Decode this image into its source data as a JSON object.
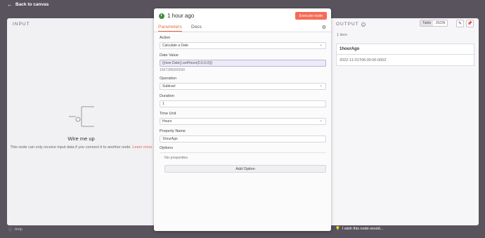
{
  "topbar": {
    "back_label": "Back to canvas"
  },
  "input_panel": {
    "label": "INPUT",
    "wire_title": "Wire me up",
    "wire_text": "This node can only receive input data if you connect it to another node.",
    "learn_more": "Learn more"
  },
  "node": {
    "title": "1 hour ago",
    "execute_label": "Execute node",
    "tabs": [
      "Parameters",
      "Docs"
    ],
    "fields": {
      "action_label": "Action",
      "action_value": "Calculate a Date",
      "date_label": "Date Value",
      "date_value": "{{new Date().setHours(0,0,0,0)}}",
      "date_hint": "1667286000000",
      "operation_label": "Operation",
      "operation_value": "Subtract",
      "duration_label": "Duration",
      "duration_value": "1",
      "time_unit_label": "Time Unit",
      "time_unit_value": "Hours",
      "property_label": "Property Name",
      "property_value": "1hourAgo",
      "options_label": "Options",
      "no_properties": "No properties",
      "add_option": "Add Option"
    }
  },
  "output_panel": {
    "label": "OUTPUT",
    "view_table": "Table",
    "view_json": "JSON",
    "items_count": "1 item",
    "column_header": "1hourAgo",
    "cell_value": "2022-11-01T06:00:00.000Z"
  },
  "bottom": {
    "help": "Help",
    "wish": "I wish this node would..."
  },
  "colors": {
    "accent": "#e06a4c",
    "execute": "#f56c56",
    "node_icon": "#3e8e41"
  }
}
